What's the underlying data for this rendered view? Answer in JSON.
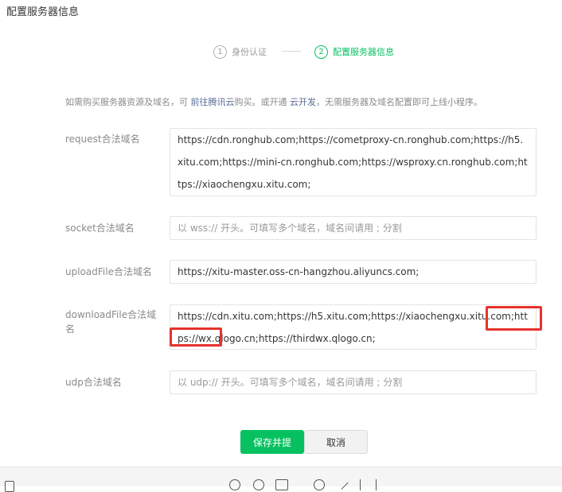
{
  "page": {
    "title": "配置服务器信息"
  },
  "stepper": {
    "steps": [
      {
        "number": "1",
        "label": "身份认证",
        "active": false
      },
      {
        "number": "2",
        "label": "配置服务器信息",
        "active": true
      }
    ]
  },
  "intro": {
    "text_before": "如需购买服务器资源及域名，可 ",
    "link1": "前往腾讯云",
    "text_middle": "购买。或开通 ",
    "link2": "云开发",
    "text_after": "，无需服务器及域名配置即可上线小程序。"
  },
  "fields": {
    "request": {
      "label": "request合法域名",
      "value": "https://cdn.ronghub.com;https://cometproxy-cn.ronghub.com;https://h5.xitu.com;https://mini-cn.ronghub.com;https://wsproxy.cn.ronghub.com;https://xiaochengxu.xitu.com;"
    },
    "socket": {
      "label": "socket合法域名",
      "placeholder": "以 wss:// 开头。可填写多个域名，域名间请用 ; 分割"
    },
    "uploadFile": {
      "label": "uploadFile合法域名",
      "value": "https://xitu-master.oss-cn-hangzhou.aliyuncs.com;"
    },
    "downloadFile": {
      "label": "downloadFile合法域名",
      "value": "https://cdn.xitu.com;https://h5.xitu.com;https://xiaochengxu.xitu.com;https://wx.qlogo.cn;https://thirdwx.qlogo.cn;"
    },
    "udp": {
      "label": "udp合法域名",
      "placeholder": "以 udp:// 开头。可填写多个域名，域名间请用 ; 分割"
    }
  },
  "actions": {
    "save": "保存并提",
    "cancel": "取消"
  },
  "colors": {
    "accent": "#07c160",
    "link": "#576b95",
    "highlight": "#e5322d"
  }
}
